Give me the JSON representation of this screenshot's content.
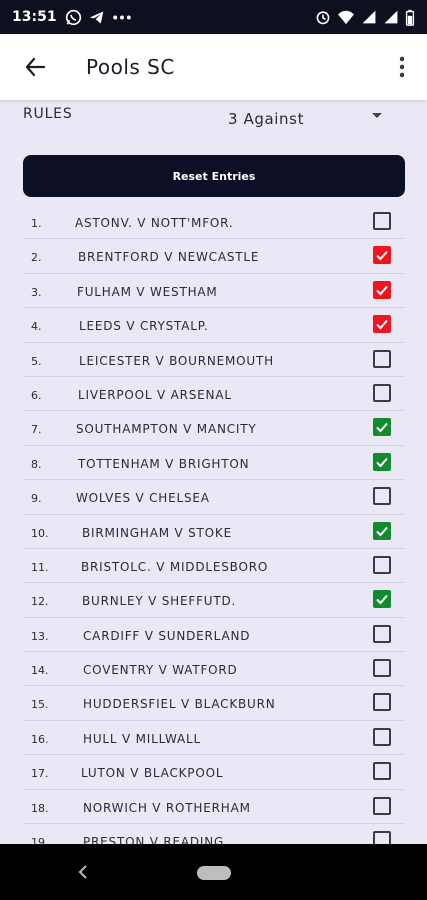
{
  "status_bar": {
    "time": "13:51"
  },
  "app_bar": {
    "title": "Pools SC"
  },
  "rules": {
    "label": "RULES",
    "selected": "3 Against"
  },
  "reset_button": {
    "label": "Reset Entries"
  },
  "colors": {
    "checked_red": "#f0141e",
    "checked_green": "#138a2e",
    "primary_dark": "#0c0f26"
  },
  "fixtures": [
    {
      "num": "1.",
      "name": "ASTONV. V NOTT'MFOR.",
      "state": "unchecked"
    },
    {
      "num": "2.",
      "name": "BRENTFORD V NEWCASTLE",
      "state": "red"
    },
    {
      "num": "3.",
      "name": "FULHAM V WESTHAM",
      "state": "red"
    },
    {
      "num": "4.",
      "name": "LEEDS V CRYSTALP.",
      "state": "red"
    },
    {
      "num": "5.",
      "name": "LEICESTER V BOURNEMOUTH",
      "state": "unchecked"
    },
    {
      "num": "6.",
      "name": "LIVERPOOL V ARSENAL",
      "state": "unchecked"
    },
    {
      "num": "7.",
      "name": "SOUTHAMPTON V MANCITY",
      "state": "green"
    },
    {
      "num": "8.",
      "name": "TOTTENHAM V BRIGHTON",
      "state": "green"
    },
    {
      "num": "9.",
      "name": "WOLVES V CHELSEA",
      "state": "unchecked"
    },
    {
      "num": "10.",
      "name": "BIRMINGHAM V STOKE",
      "state": "green"
    },
    {
      "num": "11.",
      "name": "BRISTOLC. V MIDDLESBORO",
      "state": "unchecked"
    },
    {
      "num": "12.",
      "name": "BURNLEY V SHEFFUTD.",
      "state": "green"
    },
    {
      "num": "13.",
      "name": "CARDIFF V SUNDERLAND",
      "state": "unchecked"
    },
    {
      "num": "14.",
      "name": "COVENTRY V WATFORD",
      "state": "unchecked"
    },
    {
      "num": "15.",
      "name": "HUDDERSFIEL V BLACKBURN",
      "state": "unchecked"
    },
    {
      "num": "16.",
      "name": "HULL V MILLWALL",
      "state": "unchecked"
    },
    {
      "num": "17.",
      "name": "LUTON V BLACKPOOL",
      "state": "unchecked"
    },
    {
      "num": "18.",
      "name": "NORWICH V ROTHERHAM",
      "state": "unchecked"
    },
    {
      "num": "19.",
      "name": "PRESTON V READING",
      "state": "unchecked"
    }
  ]
}
